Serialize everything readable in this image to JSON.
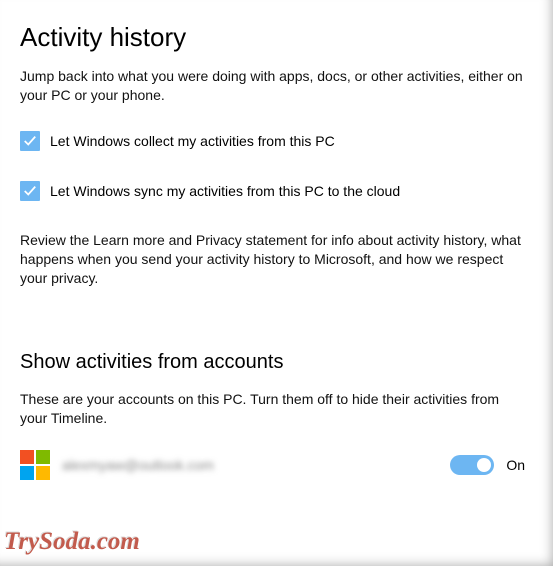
{
  "header": {
    "title": "Activity history",
    "description": "Jump back into what you were doing with apps, docs, or other activities, either on your PC or your phone."
  },
  "checks": {
    "collect": {
      "checked": true,
      "label": "Let Windows collect my activities from this PC"
    },
    "sync": {
      "checked": true,
      "label": "Let Windows sync my activities from this PC to the cloud"
    }
  },
  "review_text": "Review the Learn more and Privacy statement for info about activity history, what happens when you send your activity history to Microsoft, and how we respect your privacy.",
  "accounts_section": {
    "title": "Show activities from accounts",
    "description": "These are your accounts on this PC. Turn them off to hide their activities from your Timeline."
  },
  "account": {
    "email": "alexmyaw@outlook.com",
    "toggle": {
      "on": true,
      "label": "On"
    }
  },
  "colors": {
    "accent": "#6db6f2"
  },
  "watermark": "TrySoda.com"
}
